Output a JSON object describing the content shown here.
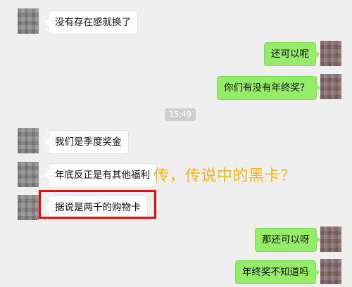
{
  "messages": [
    {
      "side": "in",
      "text": "没有存在感就换了"
    },
    {
      "side": "out",
      "text": "还可以呢"
    },
    {
      "side": "out",
      "text": "你们有没有年终奖？"
    },
    {
      "side": "in",
      "text": "我们是季度奖金"
    },
    {
      "side": "in",
      "text": "年底反正是有其他福利"
    },
    {
      "side": "in",
      "text": "据说是两千的购物卡"
    },
    {
      "side": "out",
      "text": "那还可以呀"
    },
    {
      "side": "out",
      "text": "年终奖不知道吗"
    }
  ],
  "timestamp": "15:49",
  "overlay_caption": "传，传说中的黑卡？",
  "colors": {
    "background": "#efefef",
    "outgoing_bubble": "#95ec69",
    "incoming_bubble": "#ffffff",
    "highlight": "#ea0a0a",
    "caption": "#f2b61a"
  }
}
